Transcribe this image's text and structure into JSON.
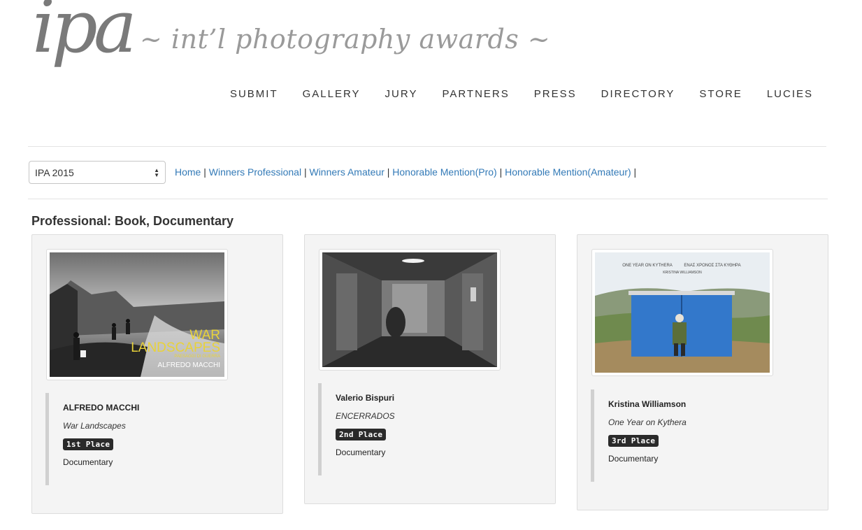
{
  "header": {
    "logo": "ipa",
    "tagline": "~ int’l photography awards ~"
  },
  "nav": [
    "SUBMIT",
    "GALLERY",
    "JURY",
    "PARTNERS",
    "PRESS",
    "DIRECTORY",
    "STORE",
    "LUCIES"
  ],
  "year_select": {
    "value": "IPA 2015"
  },
  "subnav": [
    "Home",
    "Winners Professional",
    "Winners Amateur",
    "Honorable Mention(Pro)",
    "Honorable Mention(Amateur)"
  ],
  "category_title": "Professional: Book, Documentary",
  "entries": [
    {
      "author": "ALFREDO MACCHI",
      "work": "War Landscapes",
      "place": "1st Place",
      "genre": "Documentary",
      "cover": {
        "title_line1": "WAR",
        "title_line2": "LANDSCAPES",
        "subtitle": "PAESAGGI DI GUERRA",
        "author": "ALFREDO MACCHI"
      }
    },
    {
      "author": "Valerio Bispuri",
      "work": "ENCERRADOS",
      "place": "2nd Place",
      "genre": "Documentary"
    },
    {
      "author": "Kristina Williamson",
      "work": "One Year on Kythera",
      "place": "3rd Place",
      "genre": "Documentary",
      "cover": {
        "title": "ONE YEAR ON KYTHERA",
        "title_greek": "ΕΝΑΣ ΧΡΟΝΟΣ ΣΤΑ ΚΥΘΗΡΑ",
        "author": "KRISTINA WILLIAMSON"
      }
    }
  ]
}
